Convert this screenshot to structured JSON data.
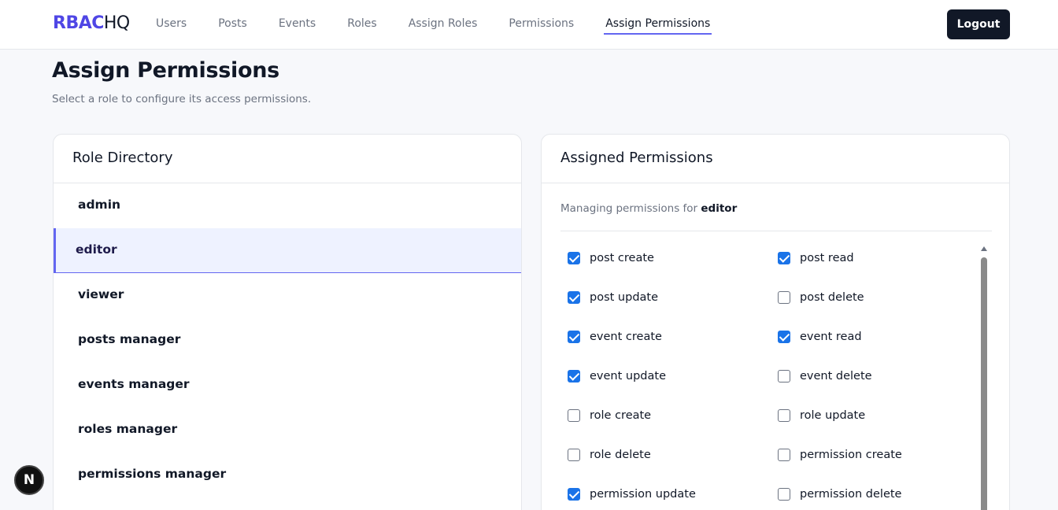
{
  "brand": {
    "part1": "RBAC",
    "part2": "HQ"
  },
  "nav": {
    "items": [
      "Users",
      "Posts",
      "Events",
      "Roles",
      "Assign Roles",
      "Permissions",
      "Assign Permissions"
    ],
    "active": "Assign Permissions",
    "logout": "Logout"
  },
  "page": {
    "title": "Assign Permissions",
    "subtitle": "Select a role to configure its access permissions."
  },
  "roles": {
    "header": "Role Directory",
    "items": [
      "admin",
      "editor",
      "viewer",
      "posts manager",
      "events manager",
      "roles manager",
      "permissions manager"
    ],
    "selected": "editor"
  },
  "permissions": {
    "header": "Assigned Permissions",
    "managing_prefix": "Managing permissions for",
    "managing_role": "editor",
    "items": [
      {
        "label": "post create",
        "checked": true
      },
      {
        "label": "post read",
        "checked": true
      },
      {
        "label": "post update",
        "checked": true
      },
      {
        "label": "post delete",
        "checked": false
      },
      {
        "label": "event create",
        "checked": true
      },
      {
        "label": "event read",
        "checked": true
      },
      {
        "label": "event update",
        "checked": true
      },
      {
        "label": "event delete",
        "checked": false
      },
      {
        "label": "role create",
        "checked": false
      },
      {
        "label": "role update",
        "checked": false
      },
      {
        "label": "role delete",
        "checked": false
      },
      {
        "label": "permission create",
        "checked": false
      },
      {
        "label": "permission update",
        "checked": true
      },
      {
        "label": "permission delete",
        "checked": false
      }
    ]
  },
  "dev_badge": "N",
  "colors": {
    "accent": "#4f46e5",
    "checkbox": "#1a73e8",
    "dark": "#111827"
  }
}
